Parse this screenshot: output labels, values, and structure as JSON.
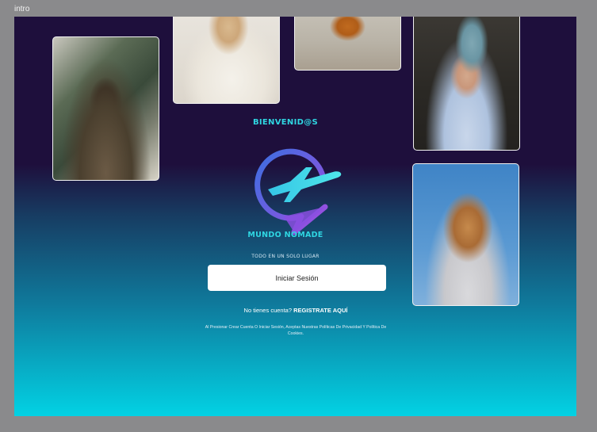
{
  "frame": {
    "label": "intro"
  },
  "photos": [
    {
      "name": "photo-woman-plants"
    },
    {
      "name": "photo-woman-white-shirt"
    },
    {
      "name": "photo-person-sitting"
    },
    {
      "name": "photo-man-beanie"
    },
    {
      "name": "photo-woman-laughing"
    }
  ],
  "intro": {
    "welcome": "BIENVENID@S",
    "brand": "MUNDO NOMADE",
    "tagline": "TODO EN UN SOLO LUGAR",
    "login_label": "Iniciar Sesión",
    "register_prompt": "No tienes cuenta?",
    "register_link": "REGISTRATE AQUÍ",
    "legal": "Al Presionar Crear Cuenta O Iniciar Sesión, Aceptas Nuestras Políticas De Privacidad Y Política De Cookies."
  },
  "colors": {
    "accent": "#2fd6e2",
    "background_top": "#1e0f3c",
    "background_bottom": "#02d2e4",
    "logo_gradient_start": "#3b6fe0",
    "logo_gradient_end": "#a24be0"
  },
  "icons": {
    "logo": "plane-location-pin-icon"
  }
}
